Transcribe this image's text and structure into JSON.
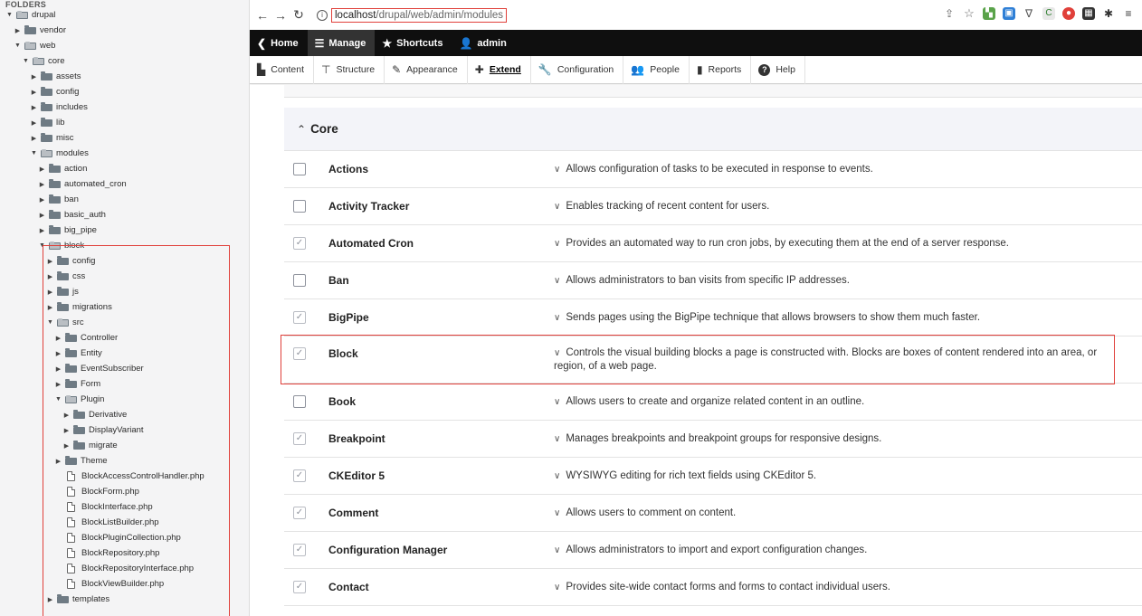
{
  "tree": {
    "header": "FOLDERS",
    "items": [
      {
        "label": "drupal",
        "depth": 0,
        "kind": "folder-open"
      },
      {
        "label": "vendor",
        "depth": 1,
        "kind": "folder"
      },
      {
        "label": "web",
        "depth": 1,
        "kind": "folder-open"
      },
      {
        "label": "core",
        "depth": 2,
        "kind": "folder-open"
      },
      {
        "label": "assets",
        "depth": 3,
        "kind": "folder"
      },
      {
        "label": "config",
        "depth": 3,
        "kind": "folder"
      },
      {
        "label": "includes",
        "depth": 3,
        "kind": "folder"
      },
      {
        "label": "lib",
        "depth": 3,
        "kind": "folder"
      },
      {
        "label": "misc",
        "depth": 3,
        "kind": "folder"
      },
      {
        "label": "modules",
        "depth": 3,
        "kind": "folder-open"
      },
      {
        "label": "action",
        "depth": 4,
        "kind": "folder"
      },
      {
        "label": "automated_cron",
        "depth": 4,
        "kind": "folder"
      },
      {
        "label": "ban",
        "depth": 4,
        "kind": "folder"
      },
      {
        "label": "basic_auth",
        "depth": 4,
        "kind": "folder"
      },
      {
        "label": "big_pipe",
        "depth": 4,
        "kind": "folder"
      },
      {
        "label": "block",
        "depth": 4,
        "kind": "folder-open"
      },
      {
        "label": "config",
        "depth": 5,
        "kind": "folder"
      },
      {
        "label": "css",
        "depth": 5,
        "kind": "folder"
      },
      {
        "label": "js",
        "depth": 5,
        "kind": "folder"
      },
      {
        "label": "migrations",
        "depth": 5,
        "kind": "folder"
      },
      {
        "label": "src",
        "depth": 5,
        "kind": "folder-open"
      },
      {
        "label": "Controller",
        "depth": 6,
        "kind": "folder"
      },
      {
        "label": "Entity",
        "depth": 6,
        "kind": "folder"
      },
      {
        "label": "EventSubscriber",
        "depth": 6,
        "kind": "folder"
      },
      {
        "label": "Form",
        "depth": 6,
        "kind": "folder"
      },
      {
        "label": "Plugin",
        "depth": 6,
        "kind": "folder-open"
      },
      {
        "label": "Derivative",
        "depth": 7,
        "kind": "folder"
      },
      {
        "label": "DisplayVariant",
        "depth": 7,
        "kind": "folder"
      },
      {
        "label": "migrate",
        "depth": 7,
        "kind": "folder"
      },
      {
        "label": "Theme",
        "depth": 6,
        "kind": "folder"
      },
      {
        "label": "BlockAccessControlHandler.php",
        "depth": 6,
        "kind": "file"
      },
      {
        "label": "BlockForm.php",
        "depth": 6,
        "kind": "file"
      },
      {
        "label": "BlockInterface.php",
        "depth": 6,
        "kind": "file"
      },
      {
        "label": "BlockListBuilder.php",
        "depth": 6,
        "kind": "file"
      },
      {
        "label": "BlockPluginCollection.php",
        "depth": 6,
        "kind": "file"
      },
      {
        "label": "BlockRepository.php",
        "depth": 6,
        "kind": "file"
      },
      {
        "label": "BlockRepositoryInterface.php",
        "depth": 6,
        "kind": "file"
      },
      {
        "label": "BlockViewBuilder.php",
        "depth": 6,
        "kind": "file"
      },
      {
        "label": "templates",
        "depth": 5,
        "kind": "folder"
      }
    ]
  },
  "browser": {
    "url_host": "localhost",
    "url_path": "/drupal/web/admin/modules"
  },
  "toolbar": {
    "home": "Home",
    "manage": "Manage",
    "shortcuts": "Shortcuts",
    "user": "admin"
  },
  "tray": {
    "items": [
      "Content",
      "Structure",
      "Appearance",
      "Extend",
      "Configuration",
      "People",
      "Reports",
      "Help"
    ],
    "icons": [
      "content-icon",
      "structure-icon",
      "appearance-icon",
      "extend-icon",
      "configuration-icon",
      "people-icon",
      "reports-icon",
      "help-icon"
    ],
    "active": "Extend"
  },
  "section": {
    "title": "Core"
  },
  "modules": [
    {
      "name": "Actions",
      "checked": false,
      "description": "Allows configuration of tasks to be executed in response to events."
    },
    {
      "name": "Activity Tracker",
      "checked": false,
      "description": "Enables tracking of recent content for users."
    },
    {
      "name": "Automated Cron",
      "checked": true,
      "description": "Provides an automated way to run cron jobs, by executing them at the end of a server response."
    },
    {
      "name": "Ban",
      "checked": false,
      "description": "Allows administrators to ban visits from specific IP addresses."
    },
    {
      "name": "BigPipe",
      "checked": true,
      "description": "Sends pages using the BigPipe technique that allows browsers to show them much faster."
    },
    {
      "name": "Block",
      "checked": true,
      "description": "Controls the visual building blocks a page is constructed with. Blocks are boxes of content rendered into an area, or region, of a web page."
    },
    {
      "name": "Book",
      "checked": false,
      "description": "Allows users to create and organize related content in an outline."
    },
    {
      "name": "Breakpoint",
      "checked": true,
      "description": "Manages breakpoints and breakpoint groups for responsive designs."
    },
    {
      "name": "CKEditor 5",
      "checked": true,
      "description": "WYSIWYG editing for rich text fields using CKEditor 5."
    },
    {
      "name": "Comment",
      "checked": true,
      "description": "Allows users to comment on content."
    },
    {
      "name": "Configuration Manager",
      "checked": true,
      "description": "Allows administrators to import and export configuration changes."
    },
    {
      "name": "Contact",
      "checked": true,
      "description": "Provides site-wide contact forms and forms to contact individual users."
    }
  ],
  "colors": {
    "highlight": "#e0403a",
    "toolbar": "#0f0f0f",
    "section_bg": "#f3f4f9"
  }
}
